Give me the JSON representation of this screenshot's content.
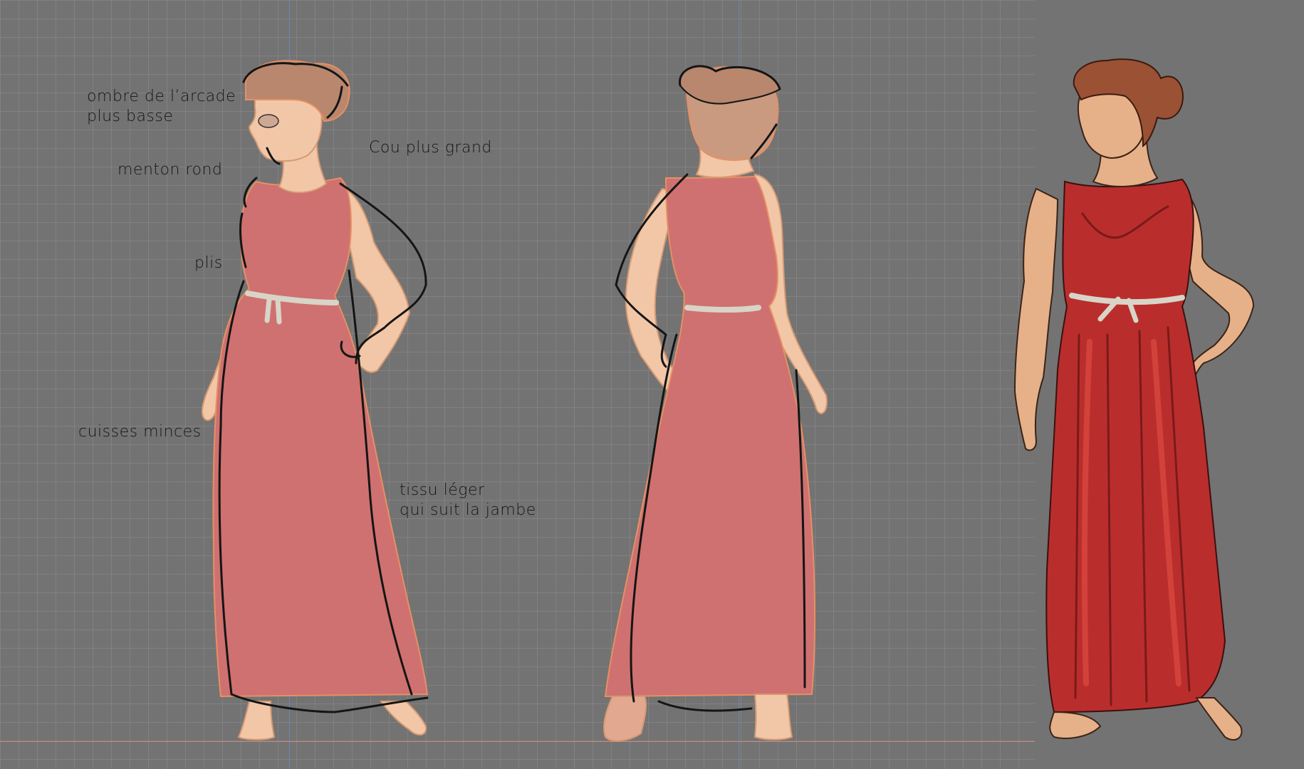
{
  "annotations": {
    "ombre": "ombre de l’arcade\nplus basse",
    "cou": "Cou plus grand",
    "menton": "menton rond",
    "plis": "plis",
    "cuisses": "cuisses minces",
    "tissu": "tissu léger\nqui suit la jambe"
  },
  "colors": {
    "canvas": "#737373",
    "sketch_dress": "#cf7170",
    "sketch_skin": "#f1c7a8",
    "sketch_hair": "#b8876e",
    "final_dress": "#b92e2c",
    "final_skin": "#e6b089",
    "final_hair": "#9b5134",
    "belt": "#d8d4c8",
    "outline": "#1a1a1a"
  },
  "icons": [
    "figure-front-sketch",
    "figure-back-sketch",
    "figure-final-colored"
  ]
}
